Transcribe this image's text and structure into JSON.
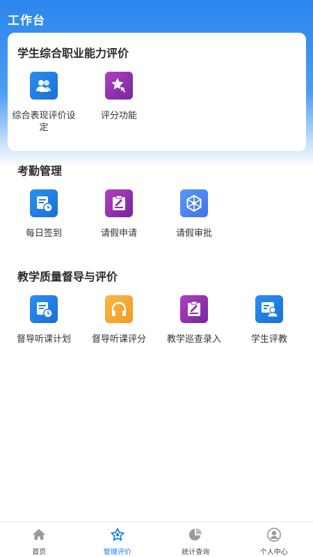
{
  "header": {
    "title": "工作台"
  },
  "sections": [
    {
      "title": "学生综合职业能力评价",
      "apps": [
        {
          "label": "综合表现评价设定",
          "icon": "users-icon",
          "color": "#1f7fe6"
        },
        {
          "label": "评分功能",
          "icon": "star-cursor-icon",
          "color": "#8e2fb0"
        }
      ]
    },
    {
      "title": "考勤管理",
      "apps": [
        {
          "label": "每日签到",
          "icon": "card-clock-icon",
          "color": "#1f7fe6"
        },
        {
          "label": "请假申请",
          "icon": "clipboard-edit-icon",
          "color": "#8e2fb0"
        },
        {
          "label": "请假审批",
          "icon": "hexagon-aperture-icon",
          "color": "#4a85f0"
        }
      ]
    },
    {
      "title": "教学质量督导与评价",
      "apps": [
        {
          "label": "督导听课计划",
          "icon": "card-clock-icon",
          "color": "#1f7fe6"
        },
        {
          "label": "督导听课评分",
          "icon": "headphones-icon",
          "color": "#f3a630"
        },
        {
          "label": "教学巡查录入",
          "icon": "clipboard-edit-icon",
          "color": "#8e2fb0"
        },
        {
          "label": "学生评教",
          "icon": "user-card-icon",
          "color": "#1f7fe6"
        }
      ]
    }
  ],
  "tabbar": {
    "items": [
      {
        "label": "首页",
        "icon": "home-icon",
        "active": false
      },
      {
        "label": "管理评价",
        "icon": "star-icon",
        "active": true
      },
      {
        "label": "统计查询",
        "icon": "pie-chart-icon",
        "active": false
      },
      {
        "label": "个人中心",
        "icon": "person-circle-icon",
        "active": false
      }
    ],
    "active_color": "#1d7fe8",
    "inactive_color": "#9a9a9a"
  }
}
